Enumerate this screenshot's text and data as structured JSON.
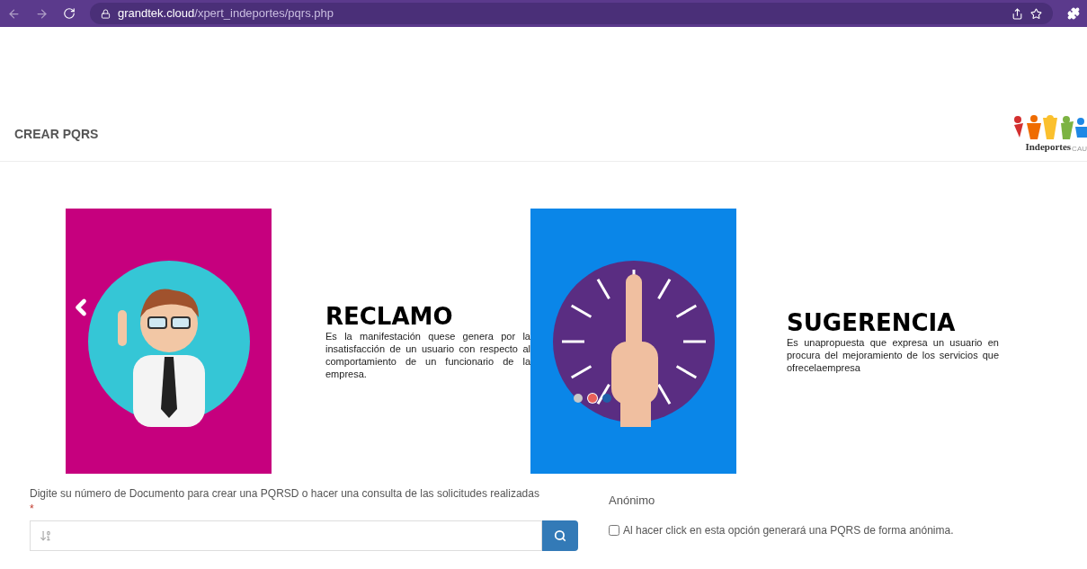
{
  "browser": {
    "url_host": "grandtek.cloud",
    "url_path": "/xpert_indeportes/pqrs.php"
  },
  "header": {
    "title": "CREAR PQRS",
    "logo_text": "Indeportes",
    "logo_suffix": "CAU"
  },
  "carousel": {
    "slides": [
      {
        "kind": "person",
        "title": "RECLAMO",
        "text": "Es la manifestación quese genera por la insatisfacción de un usuario con respecto al comportamiento de un funcionario de la empresa."
      },
      {
        "kind": "hand",
        "title": "SUGERENCIA",
        "text": "Es unapropuesta que expresa un usuario en procura del mejoramiento de los servicios que ofrecelaempresa"
      }
    ],
    "indicators": [
      {
        "selected": false,
        "color": "#c8c8c8"
      },
      {
        "selected": true,
        "color": "#e8605a"
      },
      {
        "selected": false,
        "color": "#1f5fa8"
      }
    ]
  },
  "form": {
    "document_label": "Digite su número de Documento para crear una PQRSD o hacer una consulta de las solicitudes realizadas",
    "required_mark": "*",
    "anonymous_label": "Anónimo",
    "anonymous_checkbox": {
      "label": "Al hacer click en esta opción generará una PQRS de forma anónima.",
      "checked": false
    }
  }
}
